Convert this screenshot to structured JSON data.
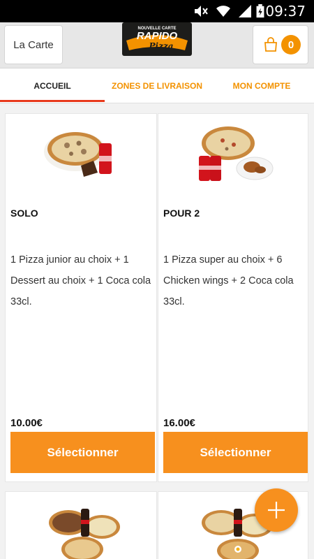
{
  "statusbar": {
    "time": "09:37"
  },
  "header": {
    "menu_label": "La Carte",
    "cart_count": "0",
    "logo": {
      "top": "NOUVELLE CARTE",
      "brand": "RAPIDO",
      "sub": "Pizza"
    }
  },
  "tabs": [
    {
      "label": "ACCUEIL"
    },
    {
      "label": "ZONES DE LIVRAISON"
    },
    {
      "label": "MON COMPTE"
    }
  ],
  "cards": [
    {
      "title": "SOLO",
      "description": "1 Pizza junior au choix  + 1 Dessert au choix  + 1 Coca cola 33cl.",
      "price": "10.00€",
      "button": "Sélectionner"
    },
    {
      "title": "POUR 2",
      "description": "1 Pizza super au choix  + 6 Chicken wings  + 2 Coca cola 33cl.",
      "price": "16.00€",
      "button": "Sélectionner"
    }
  ],
  "colors": {
    "accent": "#f7901e",
    "tab_active": "#e83a1c",
    "tab_text": "#f39200"
  }
}
